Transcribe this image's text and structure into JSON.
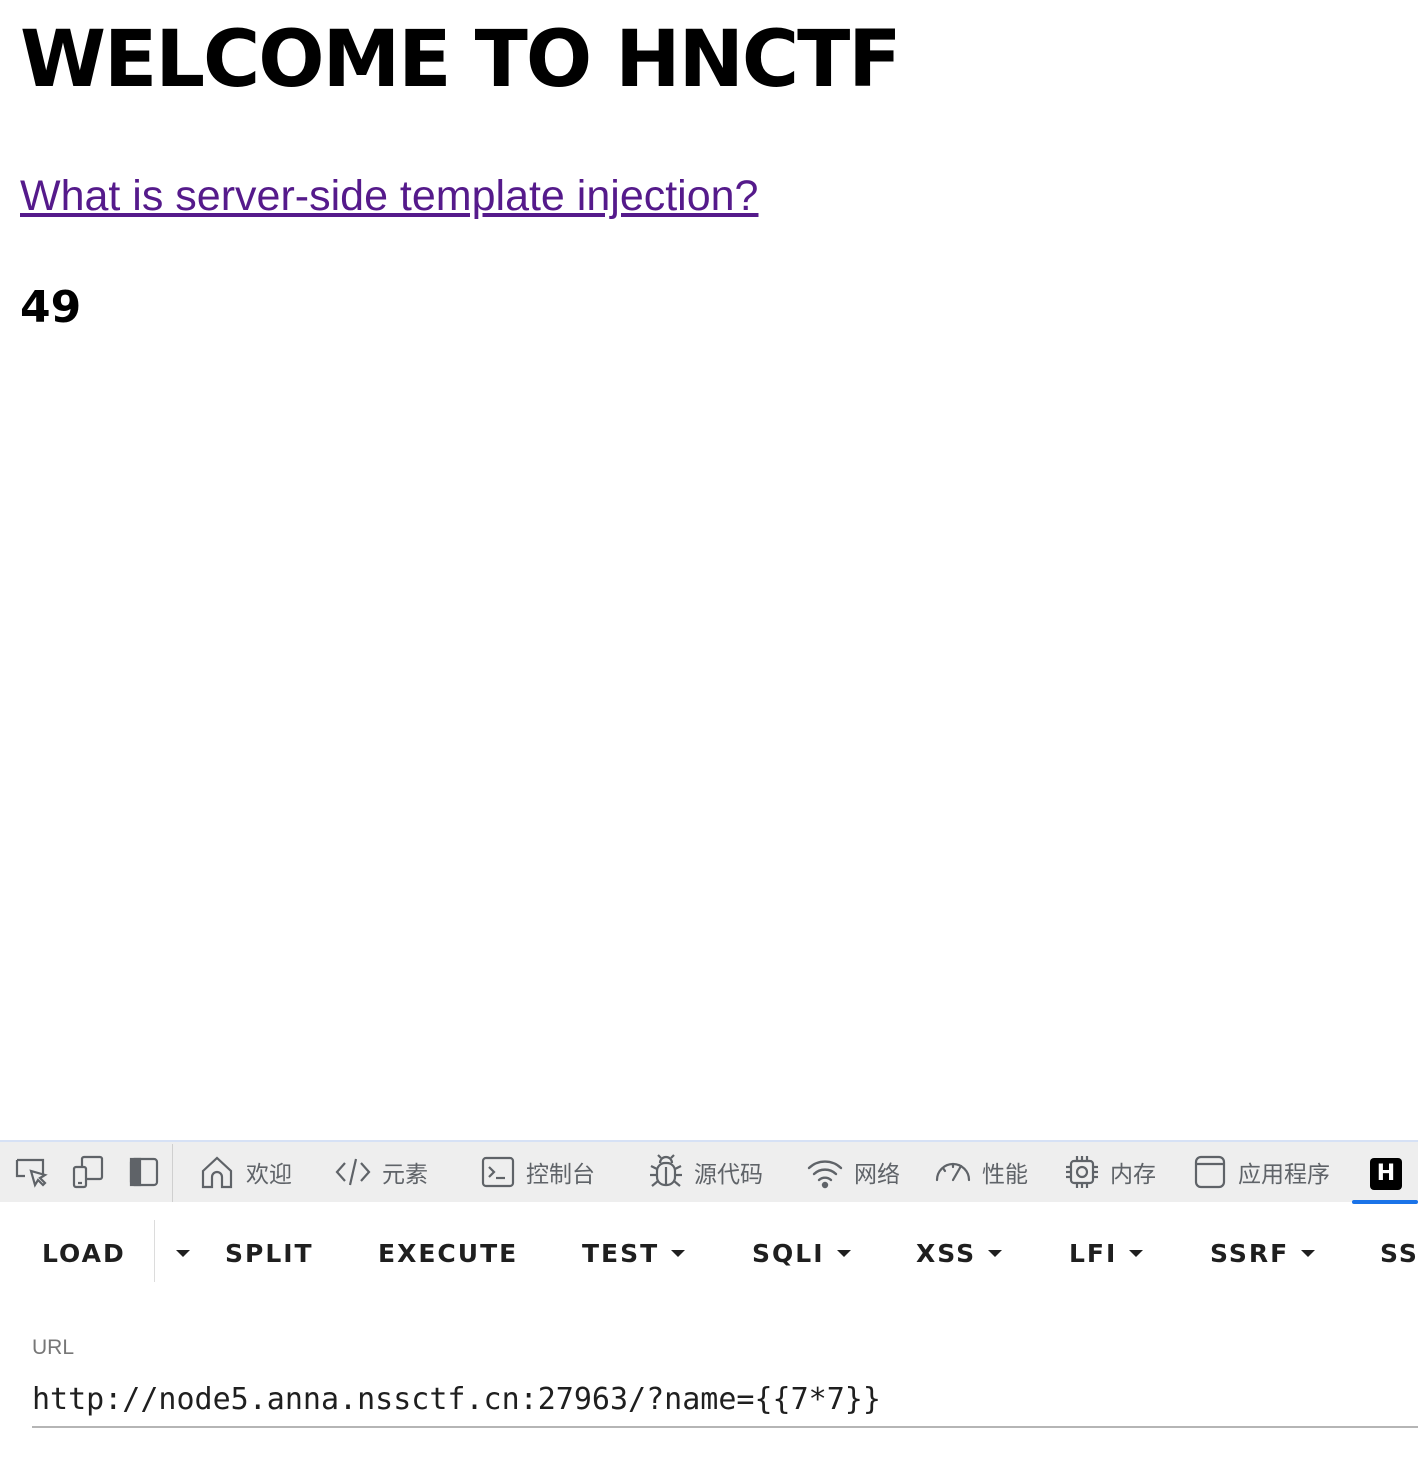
{
  "page": {
    "heading": "WELCOME TO HNCTF",
    "link_text": "What is server-side template injection?",
    "result": "49"
  },
  "devtools": {
    "tabs": [
      {
        "label": "欢迎",
        "icon": "home-icon"
      },
      {
        "label": "元素",
        "icon": "code-brackets-icon"
      },
      {
        "label": "控制台",
        "icon": "console-icon"
      },
      {
        "label": "源代码",
        "icon": "bug-icon"
      },
      {
        "label": "网络",
        "icon": "wifi-icon"
      },
      {
        "label": "性能",
        "icon": "speedometer-icon"
      },
      {
        "label": "内存",
        "icon": "chip-icon"
      },
      {
        "label": "应用程序",
        "icon": "application-icon"
      }
    ],
    "active_tab": {
      "logo": "H",
      "icon": "hackbar-icon"
    },
    "accent_color": "#1a73e8"
  },
  "hackbar": {
    "buttons": {
      "load": "LOAD",
      "split": "SPLIT",
      "execute": "EXECUTE",
      "test": "TEST",
      "sqli": "SQLI",
      "xss": "XSS",
      "lfi": "LFI",
      "ssrf": "SSRF",
      "ss": "SS"
    },
    "url_label": "URL",
    "url_value": "http://node5.anna.nssctf.cn:27963/?name={{7*7}}"
  }
}
